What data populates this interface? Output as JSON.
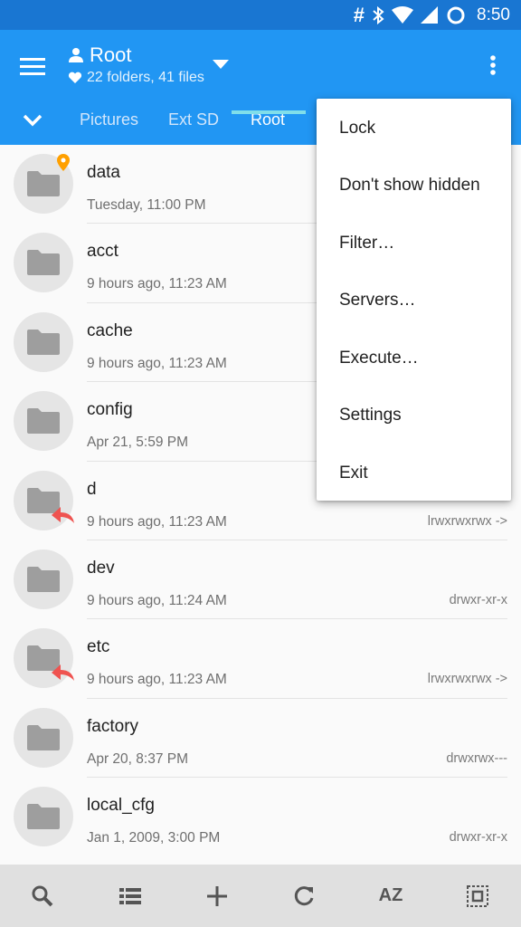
{
  "status_bar": {
    "time": "8:50",
    "icons": [
      "hash-icon",
      "bluetooth-icon",
      "wifi-icon",
      "signal-icon",
      "battery-icon"
    ]
  },
  "app_bar": {
    "title": "Root",
    "subtitle": "22 folders, 41 files",
    "accent_color": "#2196f3",
    "status_color": "#1976d2"
  },
  "tabs": {
    "items": [
      {
        "label": "Pictures"
      },
      {
        "label": "Ext SD"
      },
      {
        "label": "Root"
      }
    ],
    "active": "Root",
    "underline_color": "#80deea"
  },
  "files": [
    {
      "name": "data",
      "meta": "Tuesday, 11:00 PM",
      "perm": "",
      "badge": "pin"
    },
    {
      "name": "acct",
      "meta": "9 hours ago, 11:23 AM",
      "perm": "",
      "badge": ""
    },
    {
      "name": "cache",
      "meta": "9 hours ago, 11:23 AM",
      "perm": "",
      "badge": ""
    },
    {
      "name": "config",
      "meta": "Apr 21, 5:59 PM",
      "perm": "",
      "badge": ""
    },
    {
      "name": "d",
      "meta": "9 hours ago, 11:23 AM",
      "perm": "lrwxrwxrwx ->",
      "badge": "link"
    },
    {
      "name": "dev",
      "meta": "9 hours ago, 11:24 AM",
      "perm": "drwxr-xr-x",
      "badge": ""
    },
    {
      "name": "etc",
      "meta": "9 hours ago, 11:23 AM",
      "perm": "lrwxrwxrwx ->",
      "badge": "link"
    },
    {
      "name": "factory",
      "meta": "Apr 20, 8:37 PM",
      "perm": "drwxrwx---",
      "badge": ""
    },
    {
      "name": "local_cfg",
      "meta": "Jan 1, 2009, 3:00 PM",
      "perm": "drwxr-xr-x",
      "badge": ""
    }
  ],
  "menu": {
    "items": [
      {
        "label": "Lock"
      },
      {
        "label": "Don't show hidden"
      },
      {
        "label": "Filter…"
      },
      {
        "label": "Servers…"
      },
      {
        "label": "Execute…"
      },
      {
        "label": "Settings"
      },
      {
        "label": "Exit"
      }
    ]
  },
  "bottom_bar": {
    "sort_label": "AZ",
    "icons": [
      "search-icon",
      "list-view-icon",
      "add-icon",
      "refresh-icon",
      "sort-az-icon",
      "select-all-icon"
    ]
  }
}
